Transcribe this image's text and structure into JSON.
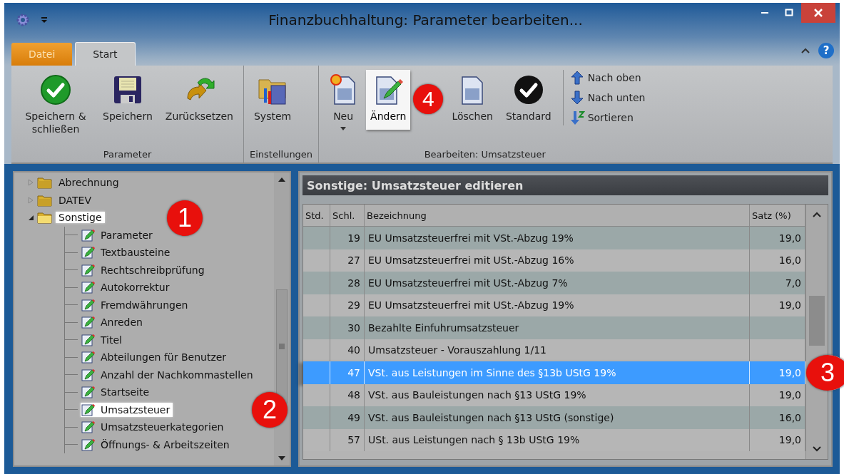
{
  "window": {
    "title": "Finanzbuchhaltung: Parameter bearbeiten..."
  },
  "ribbon_tabs": [
    {
      "label": "Datei",
      "kind": "file",
      "selected": false
    },
    {
      "label": "Start",
      "kind": "tab",
      "selected": true
    }
  ],
  "help_label": "?",
  "ribbon_groups": [
    {
      "label": "Parameter",
      "buttons": [
        {
          "label": "Speichern & schließen",
          "kind": "large",
          "highlighted": false
        },
        {
          "label": "Speichern",
          "kind": "large",
          "highlighted": false
        },
        {
          "label": "Zurücksetzen",
          "kind": "large",
          "highlighted": false
        }
      ]
    },
    {
      "label": "Einstellungen",
      "buttons": [
        {
          "label": "System",
          "kind": "large",
          "highlighted": false
        }
      ]
    },
    {
      "label": "Bearbeiten: Umsatzsteuer",
      "buttons": [
        {
          "label": "Neu",
          "kind": "dropdown",
          "highlighted": false
        },
        {
          "label": "Ändern",
          "kind": "large",
          "highlighted": true,
          "marker": "4"
        },
        {
          "label": "Löschen",
          "kind": "large",
          "highlighted": false
        },
        {
          "label": "Standard",
          "kind": "large",
          "highlighted": false
        },
        {
          "label": "Nach oben",
          "kind": "small",
          "highlighted": false
        },
        {
          "label": "Nach unten",
          "kind": "small",
          "highlighted": false
        },
        {
          "label": "Sortieren",
          "kind": "small",
          "highlighted": false
        }
      ]
    }
  ],
  "tree": {
    "items": [
      {
        "label": "Abrechnung",
        "expanded": false,
        "highlighted": false
      },
      {
        "label": "DATEV",
        "expanded": false,
        "highlighted": false
      },
      {
        "label": "Sonstige",
        "expanded": true,
        "highlighted": true,
        "marker": "1",
        "children": [
          {
            "label": "Parameter",
            "highlighted": false
          },
          {
            "label": "Textbausteine",
            "highlighted": false
          },
          {
            "label": "Rechtschreibprüfung",
            "highlighted": false
          },
          {
            "label": "Autokorrektur",
            "highlighted": false
          },
          {
            "label": "Fremdwährungen",
            "highlighted": false
          },
          {
            "label": "Anreden",
            "highlighted": false
          },
          {
            "label": "Titel",
            "highlighted": false
          },
          {
            "label": "Abteilungen für Benutzer",
            "highlighted": false
          },
          {
            "label": "Anzahl der Nachkommastellen",
            "highlighted": false
          },
          {
            "label": "Startseite",
            "highlighted": false
          },
          {
            "label": "Umsatzsteuer",
            "highlighted": true,
            "marker": "2"
          },
          {
            "label": "Umsatzsteuerkategorien",
            "highlighted": false
          },
          {
            "label": "Öffnungs- & Arbeitszeiten",
            "highlighted": false
          }
        ]
      }
    ]
  },
  "panel": {
    "title": "Sonstige: Umsatzsteuer editieren"
  },
  "table": {
    "columns": [
      "Std.",
      "Schl.",
      "Bezeichnung",
      "Satz (%)"
    ],
    "rows": [
      {
        "key": "19",
        "name": "EU Umsatzsteuerfrei mit VSt.-Abzug 19%",
        "rate": "19,0",
        "selected": false
      },
      {
        "key": "27",
        "name": "EU Umsatzsteuerfrei mit USt.-Abzug 16%",
        "rate": "16,0",
        "selected": false
      },
      {
        "key": "28",
        "name": "EU Umsatzsteuerfrei mit USt.-Abzug 7%",
        "rate": "7,0",
        "selected": false
      },
      {
        "key": "29",
        "name": "EU Umsatzsteuerfrei mit USt.-Abzug 19%",
        "rate": "19,0",
        "selected": false
      },
      {
        "key": "30",
        "name": "Bezahlte Einfuhrumsatzsteuer",
        "selected": false
      },
      {
        "key": "40",
        "name": "Umsatzsteuer - Vorauszahlung 1/11",
        "selected": false
      },
      {
        "key": "47",
        "name": "VSt. aus Leistungen im Sinne des §13b UStG 19%",
        "rate": "19,0",
        "selected": true,
        "marker": "3"
      },
      {
        "key": "48",
        "name": "VSt. aus Bauleistungen nach §13 UStG 19%",
        "rate": "19,0",
        "selected": false
      },
      {
        "key": "49",
        "name": "VSt. aus Bauleistungen nach §13 UStG (sonstige)",
        "rate": "16,0",
        "selected": false
      },
      {
        "key": "57",
        "name": "USt. aus Leistungen nach § 13b UStG 19%",
        "rate": "19,0",
        "selected": false
      }
    ]
  }
}
